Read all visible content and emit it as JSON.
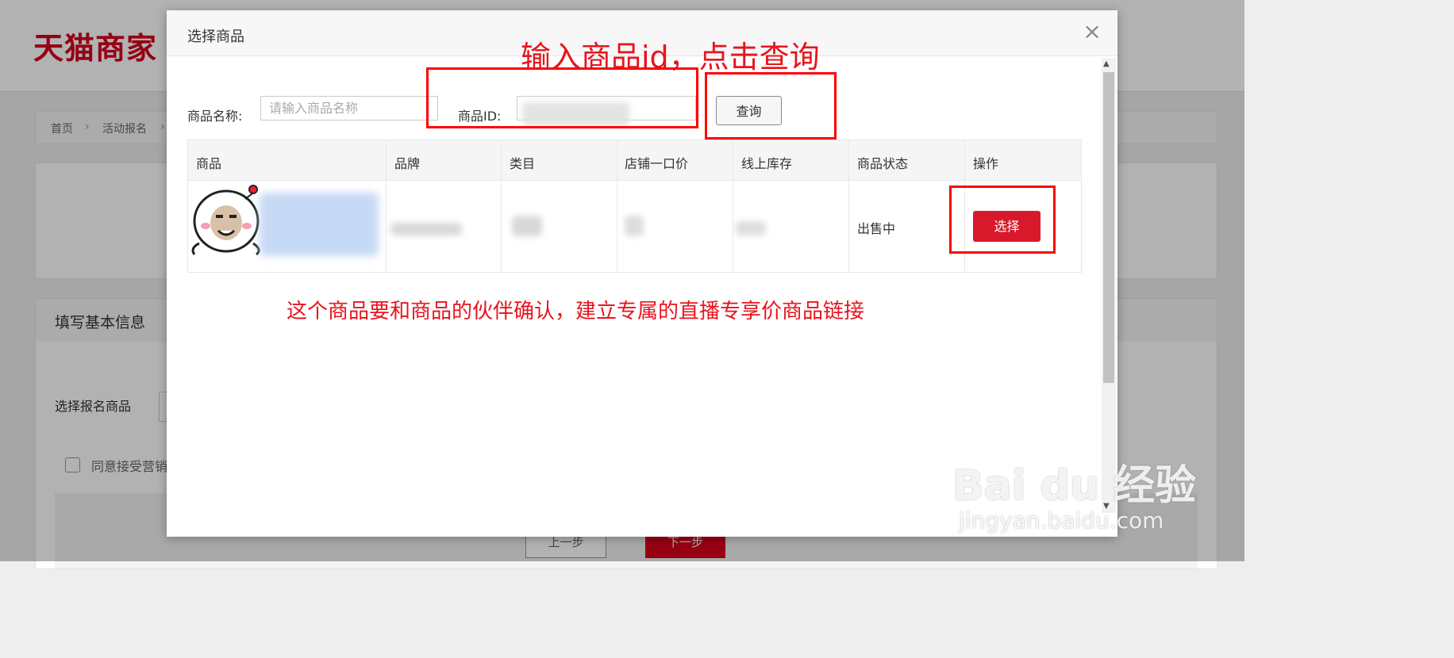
{
  "background": {
    "logo": "天猫商家",
    "breadcrumb": [
      "首页",
      "活动报名"
    ],
    "section_title": "填写基本信息",
    "select_product_label": "选择报名商品",
    "agree_label": "同意接受营销",
    "prev_button": "上一步",
    "next_button": "下一步"
  },
  "modal": {
    "title": "选择商品",
    "close_glyph": "×",
    "search": {
      "name_label": "商品名称:",
      "name_placeholder": "请输入商品名称",
      "id_label": "商品ID:",
      "query_button": "查询"
    },
    "table": {
      "headers": [
        "商品",
        "品牌",
        "类目",
        "店铺一口价",
        "线上库存",
        "商品状态",
        "操作"
      ],
      "rows": [
        {
          "status": "出售中",
          "action": "选择"
        }
      ]
    }
  },
  "annotations": {
    "top": "输入商品id，点击查询",
    "middle": "这个商品要和商品的伙伴确认，建立专属的直播专享价商品链接"
  },
  "watermark": {
    "brand": "Bai du 经验",
    "url": "jingyan.baidu.com"
  },
  "colors": {
    "brand_red": "#d8192b",
    "annotation_red": "#ff0000"
  }
}
